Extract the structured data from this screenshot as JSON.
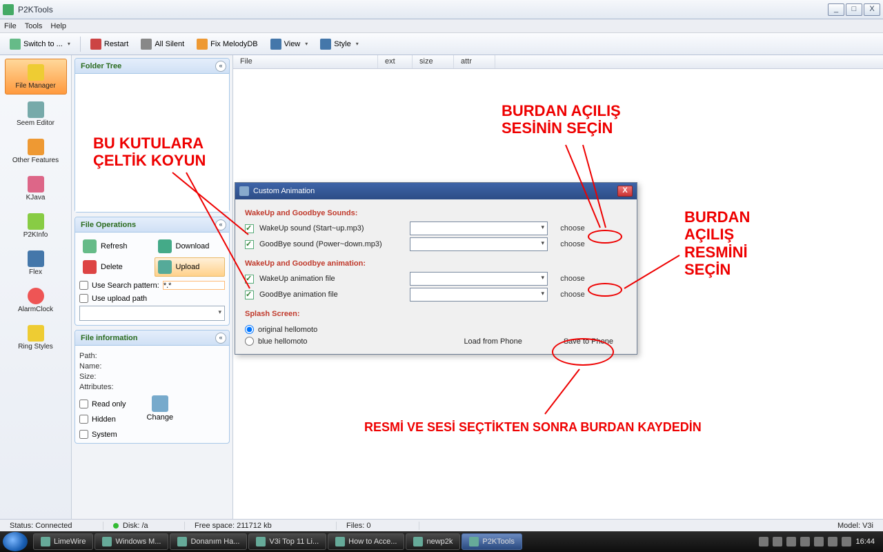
{
  "window": {
    "title": "P2KTools"
  },
  "winbtns": {
    "min": "_",
    "max": "□",
    "close": "X"
  },
  "menu": {
    "file": "File",
    "tools": "Tools",
    "help": "Help"
  },
  "toolbar": {
    "switch": "Switch to ...",
    "restart": "Restart",
    "allsilent": "All Silent",
    "fixmelody": "Fix MelodyDB",
    "view": "View",
    "style": "Style"
  },
  "nav": {
    "filemgr": "File Manager",
    "seem": "Seem Editor",
    "other": "Other Features",
    "kjava": "KJava",
    "p2kinfo": "P2KInfo",
    "flex": "Flex",
    "alarm": "AlarmClock",
    "ring": "Ring Styles"
  },
  "panels": {
    "tree": "Folder Tree",
    "ops": "File Operations",
    "info": "File information",
    "collapse": "«"
  },
  "ops": {
    "refresh": "Refresh",
    "download": "Download",
    "delete": "Delete",
    "upload": "Upload",
    "searchlbl": "Use Search pattern:",
    "searchval": "*.*",
    "uploadlbl": "Use upload path"
  },
  "info": {
    "path": "Path:",
    "name": "Name:",
    "size": "Size:",
    "attrs": "Attributes:",
    "readonly": "Read only",
    "hidden": "Hidden",
    "system": "System",
    "change": "Change"
  },
  "filecols": {
    "file": "File",
    "ext": "ext",
    "size": "size",
    "attr": "attr"
  },
  "dialog": {
    "title": "Custom Animation",
    "sounds_hd": "WakeUp and Goodbye Sounds:",
    "wakeup_snd": "WakeUp sound (Start~up.mp3)",
    "goodbye_snd": "GoodBye sound (Power~down.mp3)",
    "anim_hd": "WakeUp and Goodbye animation:",
    "wakeup_anim": "WakeUp animation file",
    "goodbye_anim": "GoodBye animation file",
    "splash_hd": "Splash Screen:",
    "splash1": "original hellomoto",
    "splash2": "blue hellomoto",
    "choose": "choose",
    "load": "Load from Phone",
    "save": "Save to Phone"
  },
  "annot": {
    "a1": "BU KUTULARA\nÇELTİK KOYUN",
    "a2": "BURDAN AÇILIŞ\nSESİNİN SEÇİN",
    "a3": "BURDAN\nAÇILIŞ\nRESMİNİ\nSEÇİN",
    "a4": "RESMİ VE SESİ SEÇTİKTEN SONRA BURDAN KAYDEDİN"
  },
  "status": {
    "conn": "Status: Connected",
    "disk": "Disk: /a",
    "free": "Free space: 211712 kb",
    "files": "Files: 0",
    "model": "Model: V3i"
  },
  "taskbar": {
    "items": [
      "LimeWire",
      "Windows M...",
      "Donanım Ha...",
      "V3i Top 11 Li...",
      "How to Acce...",
      "newp2k",
      "P2KTools"
    ],
    "clock": "16:44"
  }
}
